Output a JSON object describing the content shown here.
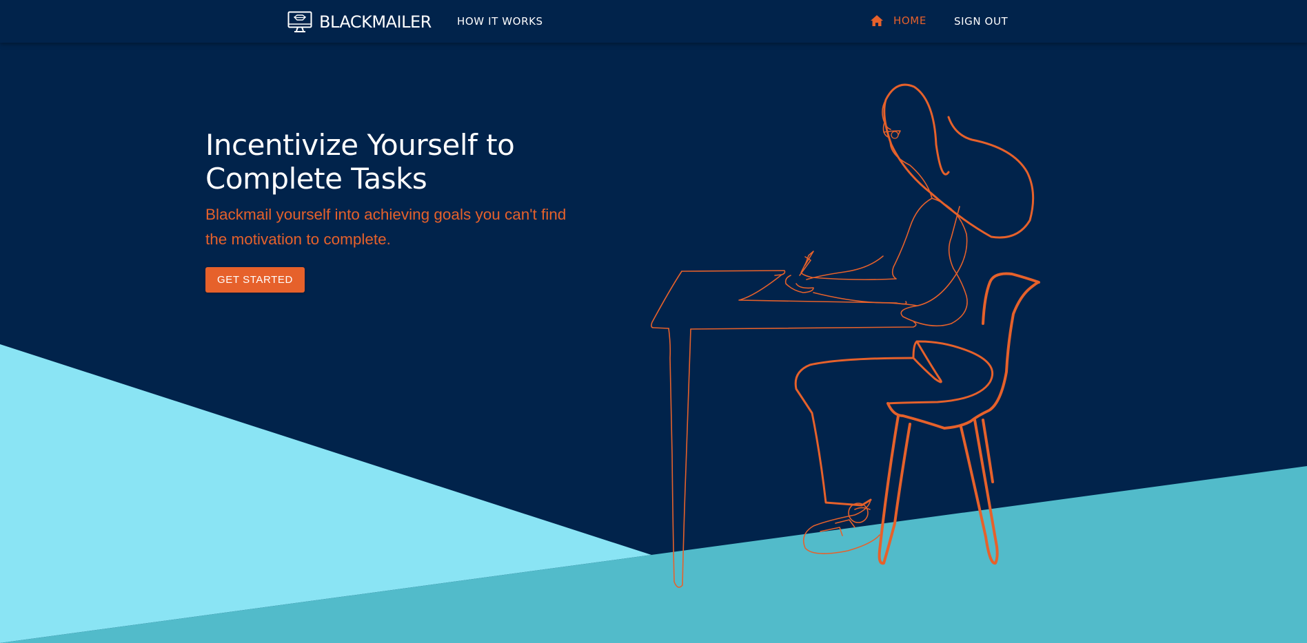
{
  "navbar": {
    "brand_name": "BLACKMAILER",
    "brand_icon": "computer-monitor-icon",
    "how_it_works_label": "HOW IT WORKS",
    "home_label": "HOME",
    "home_icon": "home-icon",
    "sign_out_label": "SIGN OUT"
  },
  "hero": {
    "title": "Incentivize Yourself to Complete Tasks",
    "subtitle": "Blackmail yourself into achieving goals you can't find the motivation to complete.",
    "cta_label": "GET STARTED"
  },
  "colors": {
    "background": "#01234b",
    "accent": "#e6612b",
    "light_cyan": "#8ae4f4",
    "teal": "#52bbca",
    "text": "#ffffff"
  }
}
